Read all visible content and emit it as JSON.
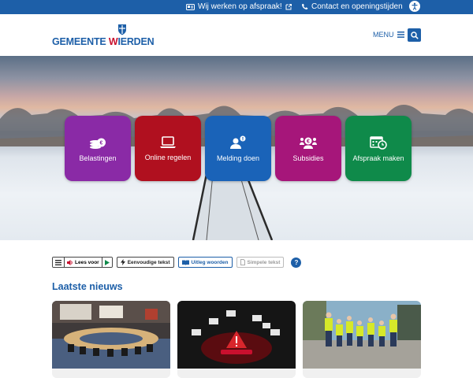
{
  "topbar": {
    "appointment_label": "Wij werken op afspraak!",
    "contact_label": "Contact en openingstijden"
  },
  "header": {
    "logo_part1": "GEMEENTE ",
    "logo_part2": "W",
    "logo_part3": "IERDEN",
    "menu_label": "MENU"
  },
  "tiles": [
    {
      "label": "Belastingen",
      "color": "#8a2aa6",
      "icon": "coins-euro-icon"
    },
    {
      "label": "Online regelen",
      "color": "#b0101f",
      "icon": "laptop-icon"
    },
    {
      "label": "Melding doen",
      "color": "#1a63b8",
      "icon": "person-alert-icon"
    },
    {
      "label": "Subsidies",
      "color": "#a6167a",
      "icon": "people-euro-icon"
    },
    {
      "label": "Afspraak maken",
      "color": "#0f8a4a",
      "icon": "calendar-clock-icon"
    }
  ],
  "toolbar": {
    "read_label": "Lees voor",
    "easy_text_label": "Eenvoudige tekst",
    "explain_words_label": "Uitleg woorden",
    "simple_text_label": "Simpele tekst",
    "help_label": "?"
  },
  "news": {
    "title": "Laatste nieuws"
  },
  "colors": {
    "brand_blue": "#1d5fa8",
    "brand_red": "#c8102e"
  }
}
